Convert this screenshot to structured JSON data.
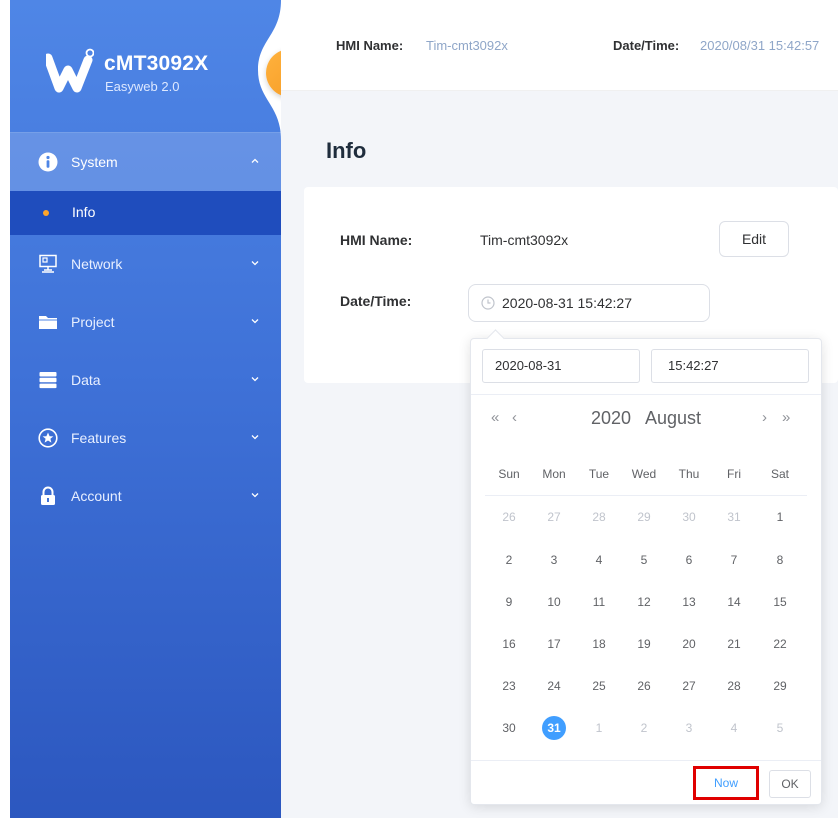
{
  "brand": {
    "title": "cMT3092X",
    "subtitle": "Easyweb 2.0"
  },
  "header": {
    "hmi_label": "HMI Name:",
    "hmi_value": "Tim-cmt3092x",
    "dt_label": "Date/Time:",
    "dt_value": "2020/08/31 15:42:57"
  },
  "sidebar": {
    "items": [
      {
        "label": "System",
        "icon": "info-icon",
        "expanded": true
      },
      {
        "label": "Network",
        "icon": "network-icon"
      },
      {
        "label": "Project",
        "icon": "folder-icon"
      },
      {
        "label": "Data",
        "icon": "database-icon"
      },
      {
        "label": "Features",
        "icon": "star-icon"
      },
      {
        "label": "Account",
        "icon": "lock-icon"
      }
    ],
    "sub_item": "Info"
  },
  "page": {
    "title": "Info",
    "hmi_label": "HMI Name:",
    "hmi_value": "Tim-cmt3092x",
    "edit_label": "Edit",
    "dt_label": "Date/Time:",
    "dt_value": "2020-08-31 15:42:27"
  },
  "picker": {
    "date_value": "2020-08-31",
    "time_value": "15:42:27",
    "prev_year": "«",
    "prev_month": "‹",
    "next_month": "›",
    "next_year": "»",
    "year": "2020",
    "month": "August",
    "weekdays": [
      "Sun",
      "Mon",
      "Tue",
      "Wed",
      "Thu",
      "Fri",
      "Sat"
    ],
    "weeks": [
      [
        "26",
        "27",
        "28",
        "29",
        "30",
        "31",
        "1"
      ],
      [
        "2",
        "3",
        "4",
        "5",
        "6",
        "7",
        "8"
      ],
      [
        "9",
        "10",
        "11",
        "12",
        "13",
        "14",
        "15"
      ],
      [
        "16",
        "17",
        "18",
        "19",
        "20",
        "21",
        "22"
      ],
      [
        "23",
        "24",
        "25",
        "26",
        "27",
        "28",
        "29"
      ],
      [
        "30",
        "31",
        "1",
        "2",
        "3",
        "4",
        "5"
      ]
    ],
    "selected_day": "31",
    "now_label": "Now",
    "ok_label": "OK"
  },
  "colors": {
    "accent": "#409eff",
    "sidebar_top": "#4f86e6",
    "sidebar_bottom": "#2c57bf",
    "collapse_button": "#f59a23",
    "highlight_box": "#e00000"
  }
}
